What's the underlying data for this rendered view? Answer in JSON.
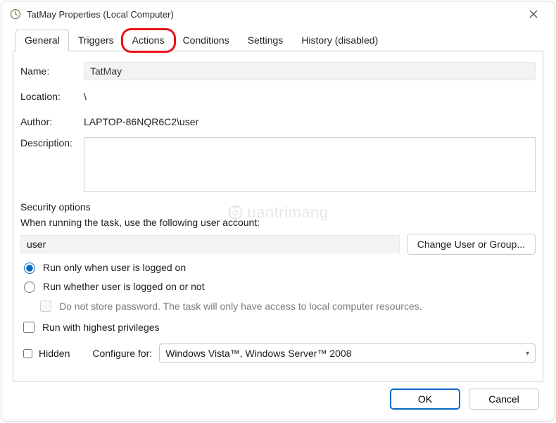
{
  "window": {
    "title": "TatMay Properties (Local Computer)"
  },
  "tabs": {
    "general": "General",
    "triggers": "Triggers",
    "actions": "Actions",
    "conditions": "Conditions",
    "settings": "Settings",
    "history": "History (disabled)"
  },
  "general": {
    "name_label": "Name:",
    "name_value": "TatMay",
    "location_label": "Location:",
    "location_value": "\\",
    "author_label": "Author:",
    "author_value": "LAPTOP-86NQR6C2\\user",
    "description_label": "Description:",
    "description_value": ""
  },
  "security": {
    "group_title": "Security options",
    "prompt": "When running the task, use the following user account:",
    "user_account": "user",
    "change_user_btn": "Change User or Group...",
    "radio_logged_on": "Run only when user is logged on",
    "radio_logged_or_not": "Run whether user is logged on or not",
    "no_store_pw": "Do not store password.  The task will only have access to local computer resources.",
    "highest_priv": "Run with highest privileges"
  },
  "bottom": {
    "hidden_label": "Hidden",
    "configure_label": "Configure for:",
    "configure_value": "Windows Vista™, Windows Server™ 2008"
  },
  "buttons": {
    "ok": "OK",
    "cancel": "Cancel"
  },
  "watermark": "uantrimang"
}
